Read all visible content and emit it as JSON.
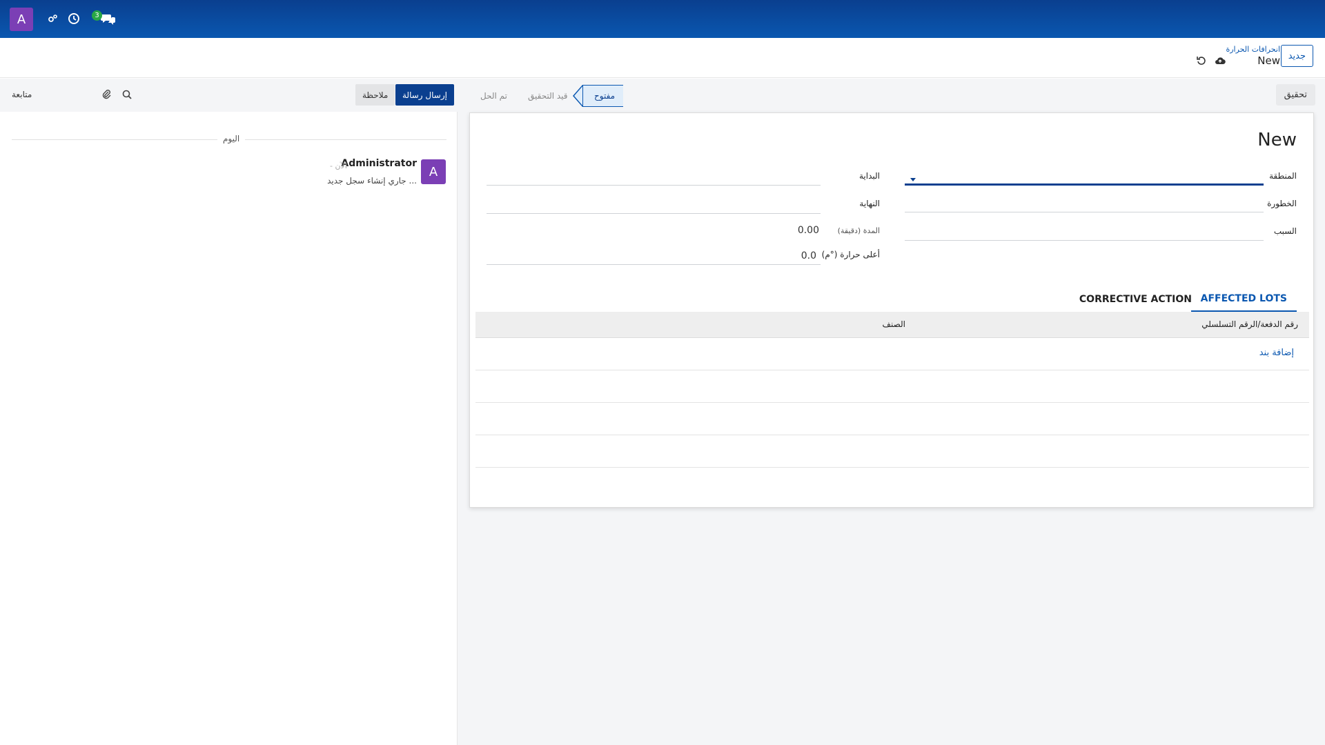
{
  "navbar": {
    "avatar_letter": "A",
    "messages_badge": "3",
    "icons": [
      "avatar",
      "debug-icon",
      "clock-icon",
      "chat-icon"
    ],
    "colors": {
      "navbar": "#0a4ea3",
      "avatar": "#7b3fb5",
      "badge": "#28a745"
    }
  },
  "control": {
    "new_button": "جديد",
    "breadcrumb_parent": "انحرافات الحرارة",
    "breadcrumb_current": "New"
  },
  "statusbar": {
    "verify_button": "تحقيق",
    "stages": [
      "مفتوح",
      "قيد التحقيق",
      "تم الحل"
    ],
    "active_stage": "مفتوح"
  },
  "form": {
    "title": "New",
    "labels": {
      "zone": "المنطقة",
      "severity": "الخطورة",
      "cause": "السبب",
      "start": "البداية",
      "end": "النهاية",
      "duration": "المدة (دقيقة)",
      "max_temp": "أعلى حرارة (°م)"
    },
    "values": {
      "zone": "",
      "severity": "",
      "cause": "",
      "start": "",
      "end": "",
      "duration": "0.00",
      "max_temp": "0.0"
    }
  },
  "tabs": {
    "affected_lots": "AFFECTED LOTS",
    "corrective_action": "CORRECTIVE ACTION"
  },
  "lots_table": {
    "columns": [
      "رقم الدفعة/الرقم التسلسلي",
      "الصنف"
    ],
    "add_line": "إضافة بند"
  },
  "chatter": {
    "send_message": "إرسال رسالة",
    "log_note": "ملاحظة",
    "follow": "متابعة",
    "day": "اليوم",
    "message": {
      "avatar_letter": "A",
      "author": "Administrator",
      "time": "- الآن",
      "body": "جاري إنشاء سجل جديد ..."
    }
  }
}
